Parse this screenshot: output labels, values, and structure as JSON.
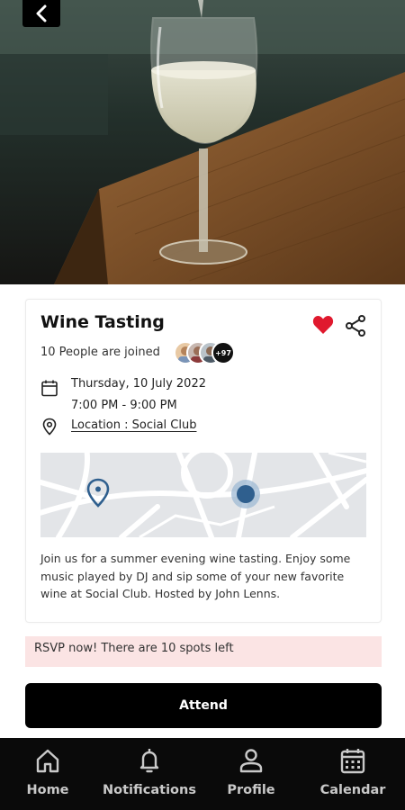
{
  "event": {
    "title": "Wine Tasting",
    "joined_text": "10 People are joined",
    "more_attendees": "+97",
    "date": "Thursday, 10 July 2022",
    "time": "7:00 PM - 9:00 PM",
    "location": "Location : Social Club",
    "description": "Join us for a summer evening wine tasting. Enjoy some music played by DJ and sip some of your new favorite wine at Social Club. Hosted by John Lenns.",
    "favorited": true
  },
  "rsvp": {
    "text": "RSVP now! There are 10  spots left"
  },
  "actions": {
    "attend_label": "Attend"
  },
  "tabbar": {
    "items": [
      {
        "label": "Home",
        "icon": "home-icon"
      },
      {
        "label": "Notifications",
        "icon": "bell-icon"
      },
      {
        "label": "Profile",
        "icon": "profile-icon"
      },
      {
        "label": "Calendar",
        "icon": "calendar-icon"
      }
    ]
  },
  "colors": {
    "accent": "#e0192e",
    "rsvp_background": "#fbe4e4",
    "primary_button": "#000000",
    "tabbar_background": "#0a0a0a",
    "map_marker": "#2f5f8e"
  }
}
